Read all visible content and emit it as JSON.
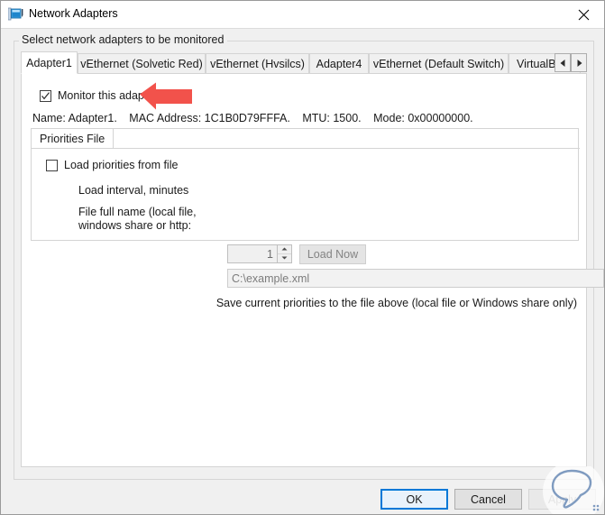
{
  "window": {
    "title": "Network Adapters",
    "app_icon": "network-adapters-icon",
    "close_label": "✕"
  },
  "groupbox": {
    "label": "Select network adapters to be monitored"
  },
  "tabs": {
    "items": [
      {
        "label": "Adapter1",
        "selected": true
      },
      {
        "label": "vEthernet (Solvetic Red)",
        "selected": false
      },
      {
        "label": "vEthernet (Hvsilcs)",
        "selected": false
      },
      {
        "label": "Adapter4",
        "selected": false
      },
      {
        "label": "vEthernet (Default Switch)",
        "selected": false
      },
      {
        "label": "VirtualBox Host-Only Net",
        "selected": false
      }
    ],
    "scroll_left_label": "◄",
    "scroll_right_label": "►"
  },
  "adapter_page": {
    "monitor_checkbox": {
      "label": "Monitor this adapter",
      "checked": true
    },
    "info": {
      "name": "Name: Adapter1.",
      "mac": "MAC Address: 1C1B0D79FFFA.",
      "mtu": "MTU: 1500.",
      "mode": "Mode: 0x00000000."
    }
  },
  "priorities_panel": {
    "tab_label": "Priorities File",
    "load_checkbox": {
      "label": "Load priorities from file",
      "checked": false
    },
    "interval_label": "Load interval, minutes",
    "interval_value": "1",
    "spin_up": "▲",
    "spin_down": "▼",
    "load_now_label": "Load Now",
    "file_label": "File full name (local file, windows share or http:",
    "file_value": "C:\\example.xml",
    "save_note": "Save current priorities to the file above (local file or Windows share only)"
  },
  "buttons": {
    "ok": "OK",
    "cancel": "Cancel",
    "apply": "Apply"
  },
  "annotations": {
    "arrow": "red-left-arrow",
    "arrow_color": "#f2524b",
    "watermark": "speech-bubble-watermark"
  },
  "colors": {
    "accent": "#0078d7",
    "window_bg": "#f0f0f0",
    "page_bg": "#ffffff",
    "border": "#d4d4d4",
    "disabled_text": "#a0a0a0"
  }
}
